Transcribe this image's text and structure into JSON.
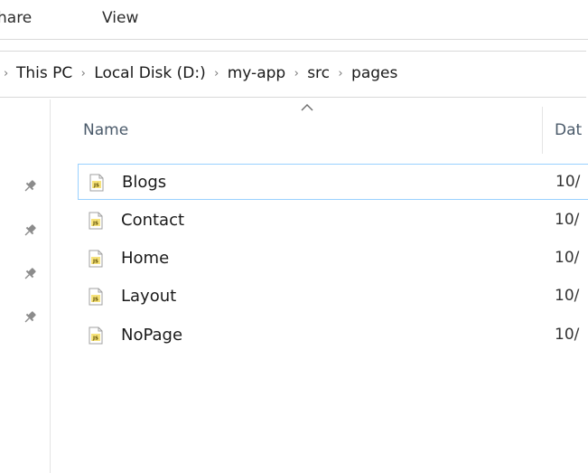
{
  "ribbon": {
    "tabs": [
      {
        "label": "hare"
      },
      {
        "label": "View"
      }
    ]
  },
  "address": {
    "crumbs": [
      "This PC",
      "Local Disk (D:)",
      "my-app",
      "src",
      "pages"
    ],
    "separator": "›"
  },
  "nav": {
    "pins": [
      "pin-icon",
      "pin-icon",
      "pin-icon",
      "pin-icon"
    ]
  },
  "columns": {
    "name": "Name",
    "date": "Dat",
    "sort": "ascending"
  },
  "files": [
    {
      "name": "Blogs",
      "date": "10/",
      "icon": "js-file-icon",
      "selected": true
    },
    {
      "name": "Contact",
      "date": "10/",
      "icon": "js-file-icon",
      "selected": false
    },
    {
      "name": "Home",
      "date": "10/",
      "icon": "js-file-icon",
      "selected": false
    },
    {
      "name": "Layout",
      "date": "10/",
      "icon": "js-file-icon",
      "selected": false
    },
    {
      "name": "NoPage",
      "date": "10/",
      "icon": "js-file-icon",
      "selected": false
    }
  ],
  "colors": {
    "selection_border": "#99d1ff",
    "js_badge": "#d4a017"
  }
}
